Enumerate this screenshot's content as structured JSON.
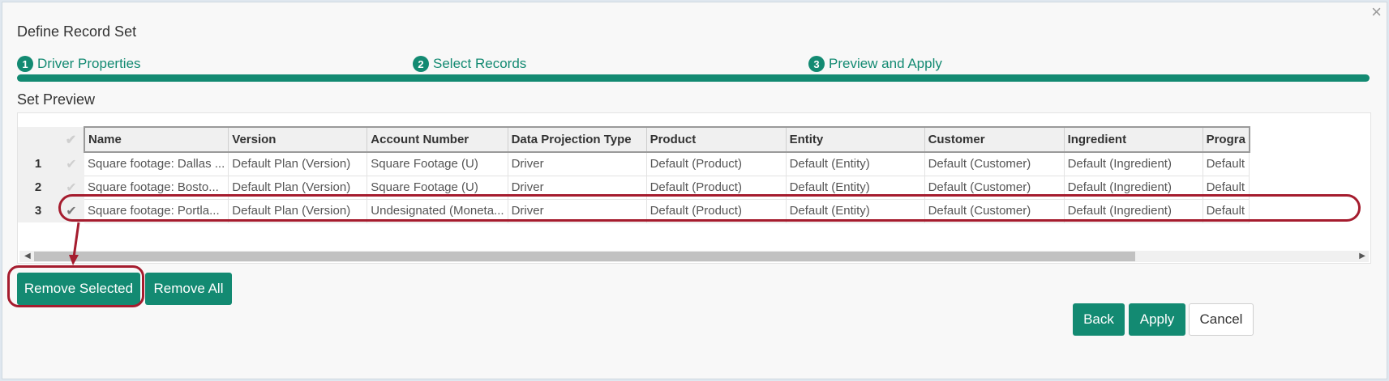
{
  "dialog": {
    "title": "Define Record Set",
    "close_glyph": "×"
  },
  "steps": [
    {
      "num": "1",
      "label": "Driver Properties"
    },
    {
      "num": "2",
      "label": "Select Records"
    },
    {
      "num": "3",
      "label": "Preview and Apply"
    }
  ],
  "section_title": "Set Preview",
  "grid": {
    "columns": [
      "Name",
      "Version",
      "Account Number",
      "Data Projection Type",
      "Product",
      "Entity",
      "Customer",
      "Ingredient",
      "Progra"
    ],
    "rows": [
      {
        "num": "1",
        "checked": false,
        "cells": [
          "Square footage: Dallas ...",
          "Default Plan (Version)",
          "Square Footage (U)",
          "Driver",
          "Default (Product)",
          "Default (Entity)",
          "Default (Customer)",
          "Default (Ingredient)",
          "Default"
        ]
      },
      {
        "num": "2",
        "checked": false,
        "cells": [
          "Square footage: Bosto...",
          "Default Plan (Version)",
          "Square Footage (U)",
          "Driver",
          "Default (Product)",
          "Default (Entity)",
          "Default (Customer)",
          "Default (Ingredient)",
          "Default"
        ]
      },
      {
        "num": "3",
        "checked": true,
        "cells": [
          "Square footage: Portla...",
          "Default Plan (Version)",
          "Undesignated (Moneta...",
          "Driver",
          "Default (Product)",
          "Default (Entity)",
          "Default (Customer)",
          "Default (Ingredient)",
          "Default"
        ]
      }
    ],
    "check_glyph": "✔",
    "scroll_left_glyph": "◀",
    "scroll_right_glyph": "▶"
  },
  "buttons": {
    "remove_selected": "Remove Selected",
    "remove_all": "Remove All",
    "back": "Back",
    "apply": "Apply",
    "cancel": "Cancel"
  },
  "colors": {
    "accent": "#138a72",
    "annotation": "#a51c2e"
  }
}
